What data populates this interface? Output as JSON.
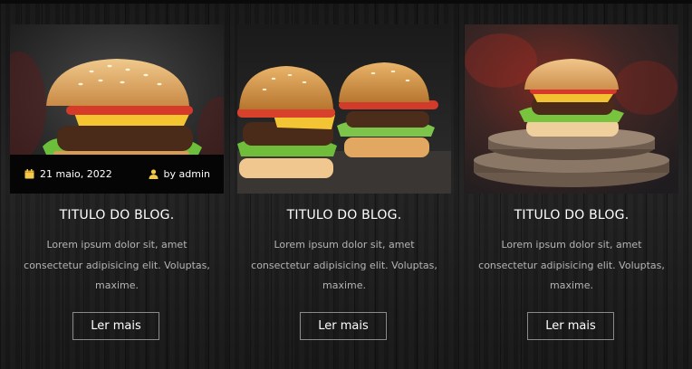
{
  "posts": [
    {
      "image_icon": "burger-photo",
      "date": "21 maio, 2022",
      "author": "by admin",
      "title": "TITULO DO BLOG.",
      "excerpt": "Lorem ipsum dolor sit, amet consectetur adipisicing elit. Voluptas, maxime.",
      "button": "Ler mais"
    },
    {
      "image_icon": "two-burgers-photo",
      "title": "TITULO DO BLOG.",
      "excerpt": "Lorem ipsum dolor sit, amet consectetur adipisicing elit. Voluptas, maxime.",
      "button": "Ler mais"
    },
    {
      "image_icon": "burger-on-wood-photo",
      "title": "TITULO DO BLOG.",
      "excerpt": "Lorem ipsum dolor sit, amet consectetur adipisicing elit. Voluptas, maxime.",
      "button": "Ler mais"
    }
  ],
  "icons": {
    "calendar": "calendar-icon",
    "user": "user-icon"
  },
  "colors": {
    "background": "#1c1c1c",
    "meta_bar": "#050505",
    "icon_accent": "#f2c94c",
    "button_border": "#8a8a8a",
    "excerpt_text": "#b4b4b4"
  }
}
